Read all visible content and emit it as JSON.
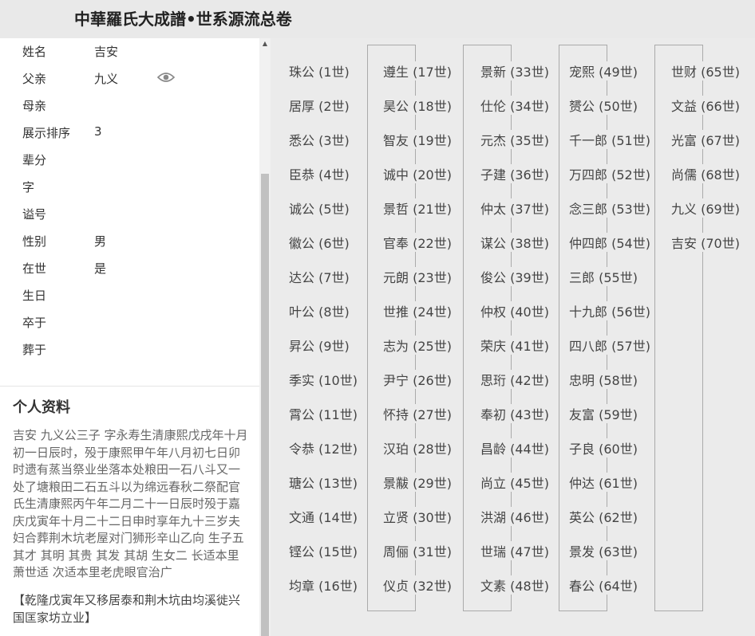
{
  "header": {
    "title": "中華羅氏大成譜•世系源流总卷"
  },
  "profile": {
    "name_label": "姓名",
    "name_value": "吉安",
    "father_label": "父亲",
    "father_value": "九义",
    "mother_label": "母亲",
    "mother_value": "",
    "order_label": "展示排序",
    "order_value": "3",
    "generation_label": "辈分",
    "generation_value": "",
    "courtesy_label": "字",
    "courtesy_value": "",
    "posthumous_label": "谥号",
    "posthumous_value": "",
    "gender_label": "性别",
    "gender_value": "男",
    "alive_label": "在世",
    "alive_value": "是",
    "birth_label": "生日",
    "birth_value": "",
    "death_label": "卒于",
    "death_value": "",
    "burial_label": "葬于",
    "burial_value": ""
  },
  "bio": {
    "title": "个人资料",
    "text": "吉安 九义公三子 字永寿生清康熙戊戌年十月初一日辰时，殁于康熙甲午年八月初七日卯时遗有蒸当祭业坐落本处粮田一石八斗又一处了塘粮田二石五斗以为绵远春秋二祭配官氏生清康熙丙午年二月二十一日辰时殁于嘉庆戊寅年十月二十二日申时享年九十三岁夫妇合葬荆木坑老屋对门狮形辛山乙向 生子五 其才 其明 其贵 其发 其胡 生女二 长适本里萧世适 次适本里老虎眼官治广",
    "note": "【乾隆戊寅年又移居泰和荆木坑由均溪徙兴国匡家坊立业】"
  },
  "generations": [
    "珠公 (1世)",
    "遵生 (17世)",
    "景新 (33世)",
    "宠熙 (49世)",
    "世财 (65世)",
    "居厚 (2世)",
    "昊公 (18世)",
    "仕伦 (34世)",
    "赟公 (50世)",
    "文益 (66世)",
    "悉公 (3世)",
    "智友 (19世)",
    "元杰 (35世)",
    "千一郎 (51世)",
    "光富 (67世)",
    "臣恭 (4世)",
    "诚中 (20世)",
    "子建 (36世)",
    "万四郎 (52世)",
    "尚儒 (68世)",
    "诚公 (5世)",
    "景哲 (21世)",
    "仲太 (37世)",
    "念三郎 (53世)",
    "九义 (69世)",
    "徽公 (6世)",
    "官奉 (22世)",
    "谋公 (38世)",
    "仲四郎 (54世)",
    "吉安 (70世)",
    "达公 (7世)",
    "元朗 (23世)",
    "俊公 (39世)",
    "三郎 (55世)",
    "",
    "叶公 (8世)",
    "世推 (24世)",
    "仲权 (40世)",
    "十九郎 (56世)",
    "",
    "昇公 (9世)",
    "志为 (25世)",
    "荣庆 (41世)",
    "四八郎 (57世)",
    "",
    "季实 (10世)",
    "尹宁 (26世)",
    "思珩 (42世)",
    "忠明 (58世)",
    "",
    "霄公 (11世)",
    "怀持 (27世)",
    "奉初 (43世)",
    "友富 (59世)",
    "",
    "令恭 (12世)",
    "汉珀 (28世)",
    "昌龄 (44世)",
    "子良 (60世)",
    "",
    "瑭公 (13世)",
    "景黻 (29世)",
    "尚立 (45世)",
    "仲达 (61世)",
    "",
    "文通 (14世)",
    "立贤 (30世)",
    "洪湖 (46世)",
    "英公 (62世)",
    "",
    "铿公 (15世)",
    "周俪 (31世)",
    "世瑞 (47世)",
    "景发 (63世)",
    "",
    "均章 (16世)",
    "仪贞 (32世)",
    "文素 (48世)",
    "春公 (64世)",
    ""
  ]
}
